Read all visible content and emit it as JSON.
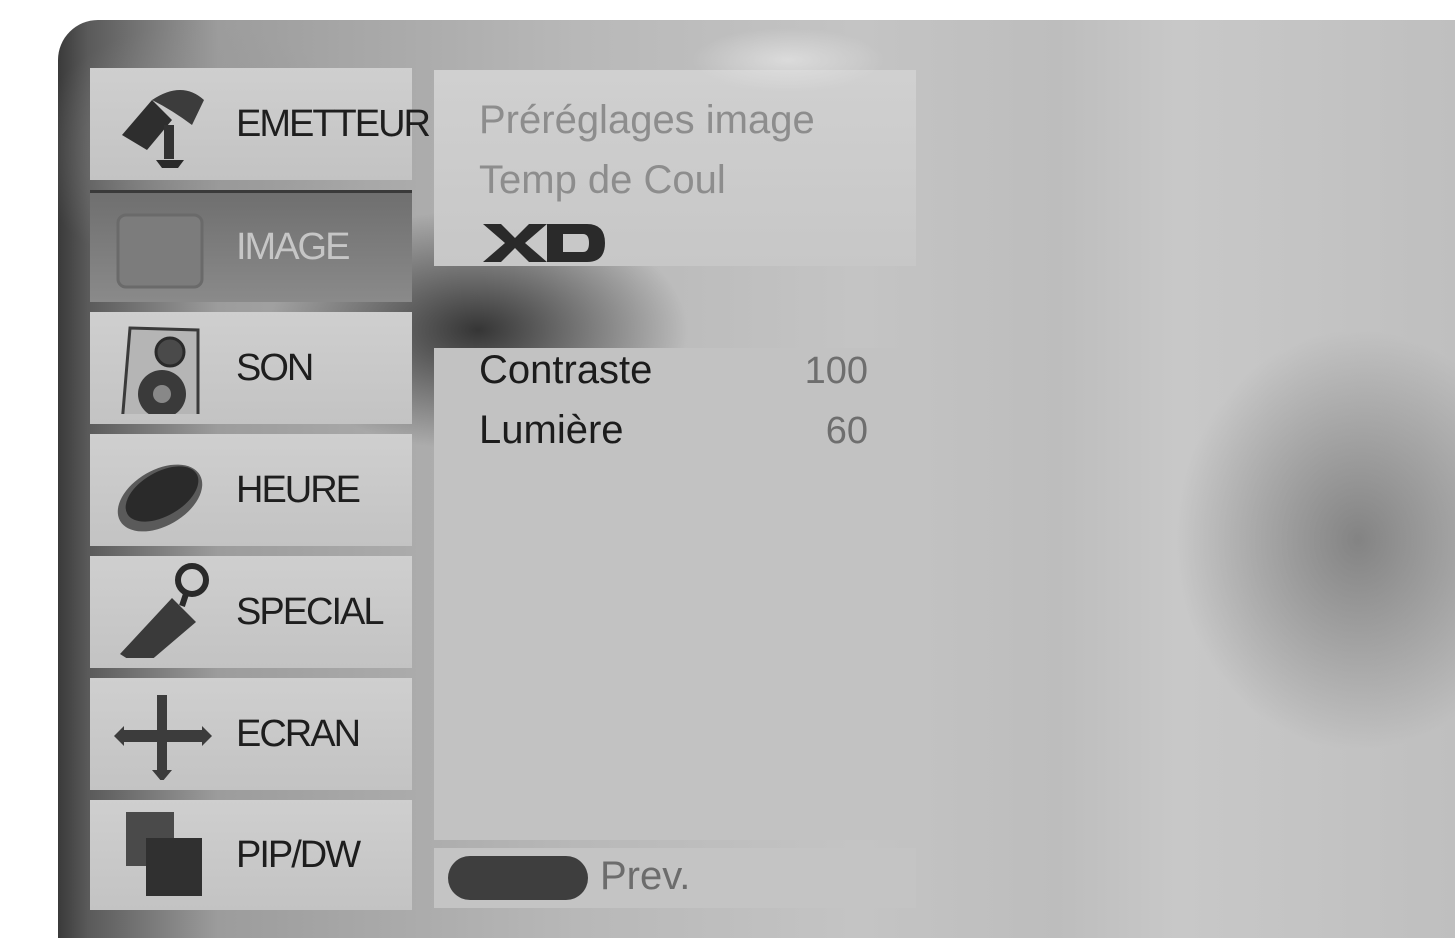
{
  "menu": {
    "items": [
      {
        "label": "EMETTEUR",
        "icon": "satellite-dish-icon",
        "selected": false
      },
      {
        "label": "IMAGE",
        "icon": "picture-icon",
        "selected": true
      },
      {
        "label": "SON",
        "icon": "speaker-icon",
        "selected": false
      },
      {
        "label": "HEURE",
        "icon": "clock-icon",
        "selected": false
      },
      {
        "label": "SPECIAL",
        "icon": "key-tag-icon",
        "selected": false
      },
      {
        "label": "ECRAN",
        "icon": "move-arrows-icon",
        "selected": false
      },
      {
        "label": "PIP/DW",
        "icon": "pip-icon",
        "selected": false
      }
    ]
  },
  "submenu": {
    "items": [
      {
        "label": "Préréglages image"
      },
      {
        "label": "Temp de Coul"
      },
      {
        "label": "XD",
        "icon": "xd-logo-icon"
      }
    ]
  },
  "adjustments": {
    "rows": [
      {
        "label": "Contraste",
        "value": "100"
      },
      {
        "label": "Lumière",
        "value": "60"
      }
    ]
  },
  "footer": {
    "prev_label": "Prev.",
    "button_icon": "remote-button-icon"
  },
  "colors": {
    "panel": "#c2c2c2",
    "selected_tile": "#7a7a7a",
    "text_dark": "#1c1c1c",
    "text_dim": "#8d8d8d"
  }
}
